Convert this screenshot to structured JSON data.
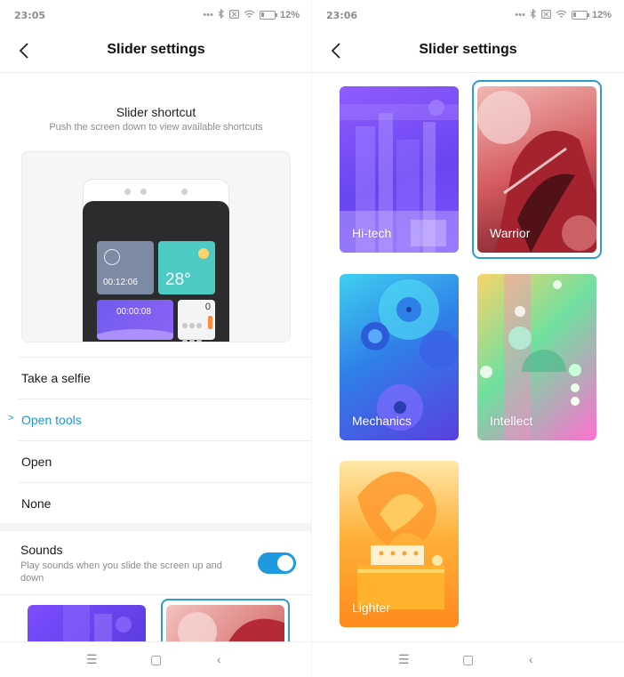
{
  "left": {
    "status": {
      "time": "23:05",
      "battery": "12%"
    },
    "header": {
      "title": "Slider settings"
    },
    "shortcut": {
      "title": "Slider shortcut",
      "subtitle": "Push the screen down to view available shortcuts",
      "preview": {
        "timer": "00:12:06",
        "temperature": "28°",
        "stopwatch": "00:00:08",
        "calc_display": "0"
      }
    },
    "options": [
      {
        "label": "Take a selfie",
        "selected": false
      },
      {
        "label": "Open tools",
        "selected": true
      },
      {
        "label": "Open",
        "selected": false
      },
      {
        "label": "None",
        "selected": false
      }
    ],
    "sounds": {
      "title": "Sounds",
      "description": "Play sounds when you slide the screen up and down",
      "enabled": true
    }
  },
  "right": {
    "status": {
      "time": "23:06",
      "battery": "12%"
    },
    "header": {
      "title": "Slider settings"
    },
    "themes": [
      {
        "name": "Hi-tech",
        "selected": false
      },
      {
        "name": "Warrior",
        "selected": true
      },
      {
        "name": "Mechanics",
        "selected": false
      },
      {
        "name": "Intellect",
        "selected": false
      },
      {
        "name": "Lighter",
        "selected": false
      }
    ]
  },
  "colors": {
    "accent": "#1c98d6",
    "toggle_on": "#1f99e0",
    "selection_border": "#2c9bd8"
  },
  "icons": {
    "back": "chevron-left-icon",
    "nav_menu": "menu-icon",
    "nav_home": "home-icon",
    "nav_back": "back-icon"
  }
}
